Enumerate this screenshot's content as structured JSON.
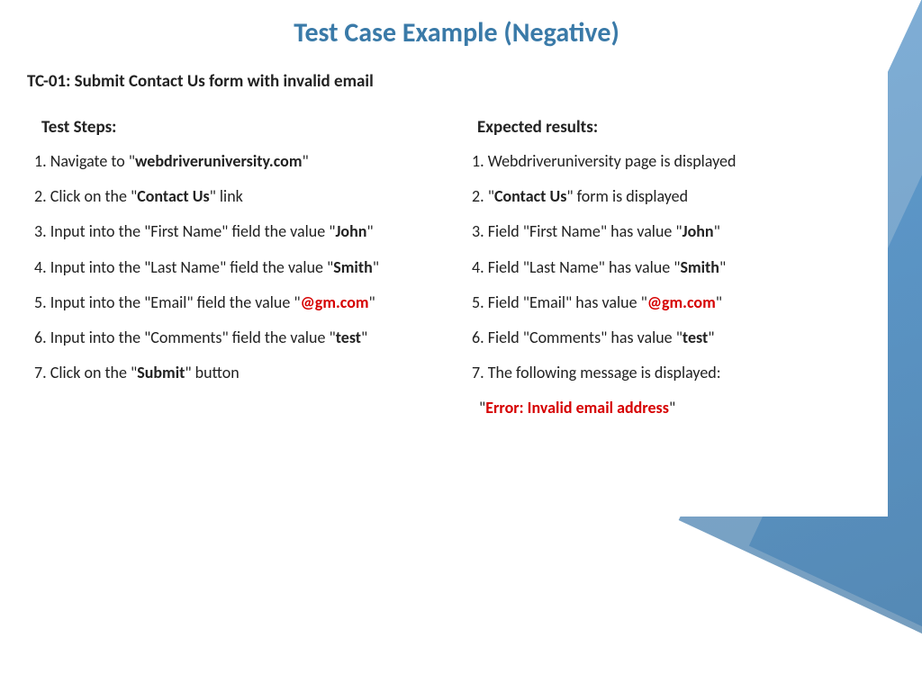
{
  "title": "Test Case Example (Negative)",
  "subtitle": "TC-01: Submit Contact Us form with invalid email",
  "left": {
    "header": "Test Steps:",
    "step1_pre": "1. Navigate to \"",
    "step1_bold": "webdriveruniversity.com",
    "step1_post": "\"",
    "step2_pre": "2. Click on the \"",
    "step2_bold": "Contact Us",
    "step2_post": "\" link",
    "step3_pre": "3. Input into the \"First Name\" field the value \"",
    "step3_bold": "John",
    "step3_post": "\"",
    "step4_pre": "4. Input into the \"Last Name\" field the value \"",
    "step4_bold": "Smith",
    "step4_post": "\"",
    "step5_pre": "5. Input into the \"Email\" field the value \"",
    "step5_bold": "@gm.com",
    "step5_post": "\"",
    "step6_pre": "6. Input into the \"Comments\" field the value \"",
    "step6_bold": "test",
    "step6_post": "\"",
    "step7_pre": "7. Click on the \"",
    "step7_bold": "Submit",
    "step7_post": "\" button"
  },
  "right": {
    "header": "Expected results:",
    "r1": "1. Webdriveruniversity page is displayed",
    "r2_pre": "2. \"",
    "r2_bold": "Contact Us",
    "r2_post": "\" form is displayed",
    "r3_pre": "3. Field \"First Name\" has value \"",
    "r3_bold": "John",
    "r3_post": "\"",
    "r4_pre": "4. Field \"Last Name\" has value \"",
    "r4_bold": "Smith",
    "r4_post": "\"",
    "r5_pre": "5. Field \"Email\" has value \"",
    "r5_bold": "@gm.com",
    "r5_post": "\"",
    "r6_pre": "6. Field \"Comments\" has value \"",
    "r6_bold": "test",
    "r6_post": "\"",
    "r7": "7. The following message is displayed:",
    "r8_pre": "   \"",
    "r8_err": "Error: Invalid email address",
    "r8_post": "\""
  }
}
